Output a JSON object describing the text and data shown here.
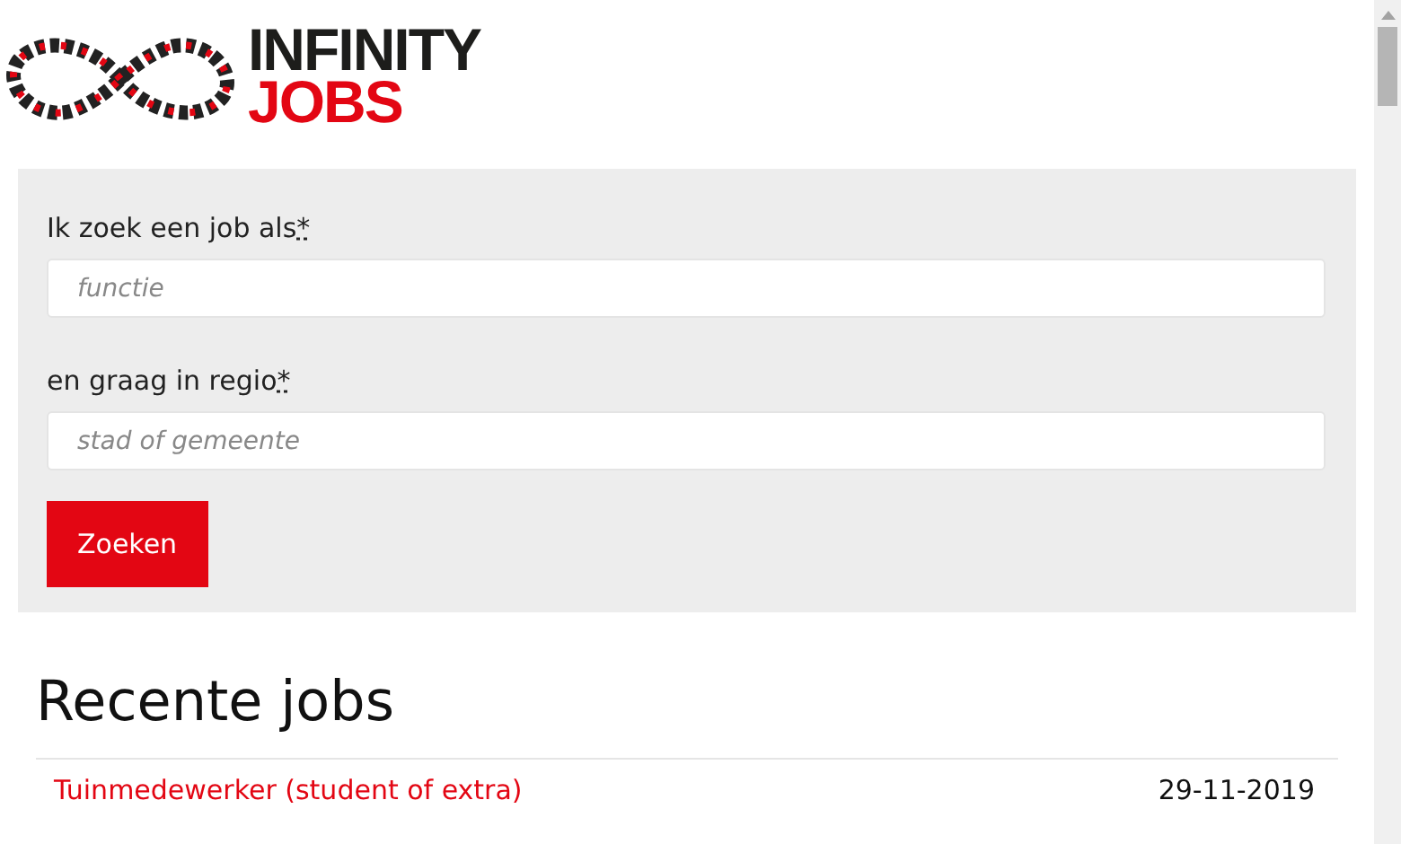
{
  "logo": {
    "line_1": "INFINITY",
    "line_2": "JOBS"
  },
  "search": {
    "job_label": "Ik zoek een job als",
    "job_required": "*",
    "job_placeholder": "functie",
    "region_label": "en graag in regio",
    "region_required": "*",
    "region_placeholder": "stad of gemeente",
    "button": "Zoeken"
  },
  "recent": {
    "title": "Recente jobs",
    "jobs": [
      {
        "title": "Tuinmedewerker (student of extra)",
        "date": "29-11-2019"
      }
    ]
  }
}
